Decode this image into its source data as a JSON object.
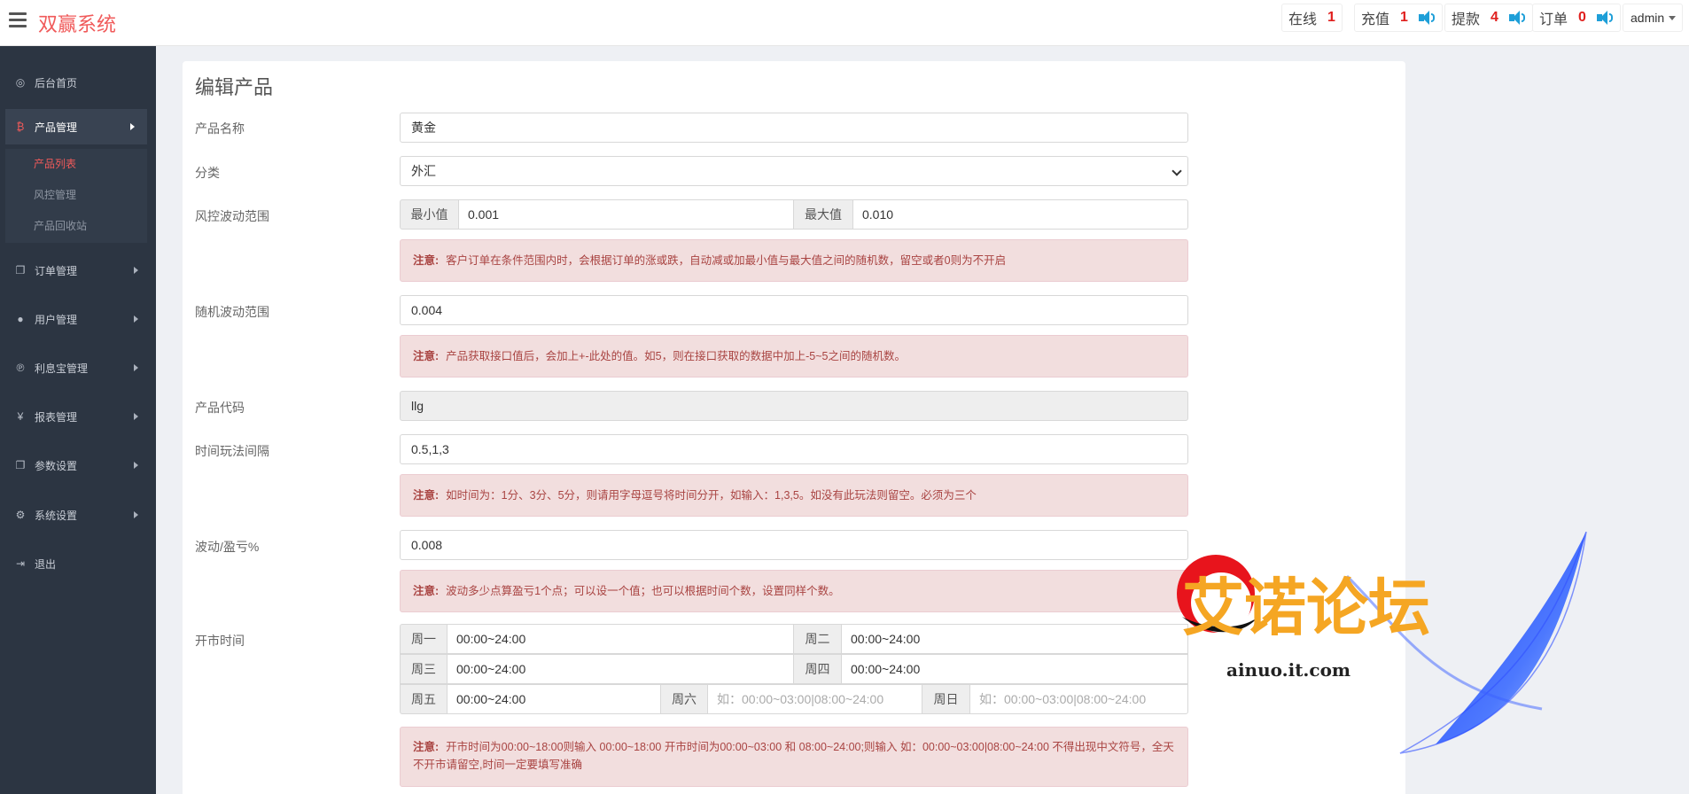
{
  "header": {
    "brand": "双赢系统",
    "stats": [
      {
        "label": "在线",
        "value": "1",
        "speaker": false
      },
      {
        "label": "充值",
        "value": "1",
        "speaker": true
      },
      {
        "label": "提款",
        "value": "4",
        "speaker": true
      },
      {
        "label": "订单",
        "value": "0",
        "speaker": true
      }
    ],
    "user": "admin"
  },
  "sidebar": {
    "items": [
      {
        "label": "后台首页",
        "icon": "dashboard-icon"
      },
      {
        "label": "产品管理",
        "icon": "bitcoin-icon"
      },
      {
        "label": "订单管理",
        "icon": "copy-icon"
      },
      {
        "label": "用户管理",
        "icon": "user-icon"
      },
      {
        "label": "利息宝管理",
        "icon": "pinterest-icon"
      },
      {
        "label": "报表管理",
        "icon": "yen-icon"
      },
      {
        "label": "参数设置",
        "icon": "copy-icon"
      },
      {
        "label": "系统设置",
        "icon": "cogs-icon"
      },
      {
        "label": "退出",
        "icon": "sign-out-icon"
      }
    ],
    "sub_items": [
      "产品列表",
      "风控管理",
      "产品回收站"
    ]
  },
  "form": {
    "title": "编辑产品",
    "name_label": "产品名称",
    "name_value": "黄金",
    "category_label": "分类",
    "category_value": "外汇",
    "risk_label": "风控波动范围",
    "min_label": "最小值",
    "min_value": "0.001",
    "max_label": "最大值",
    "max_value": "0.010",
    "note_prefix": "注意:",
    "risk_note": "客户订单在条件范围内时，会根据订单的涨或跌，自动减或加最小值与最大值之间的随机数，留空或者0则为不开启",
    "random_label": "随机波动范围",
    "random_value": "0.004",
    "random_note": "产品获取接口值后，会加上+-此处的值。如5，则在接口获取的数据中加上-5~5之间的随机数。",
    "code_label": "产品代码",
    "code_value": "llg",
    "interval_label": "时间玩法间隔",
    "interval_value": "0.5,1,3",
    "interval_note": "如时间为：1分、3分、5分，则请用字母逗号将时间分开，如输入：1,3,5。如没有此玩法则留空。必须为三个",
    "profit_label": "波动/盈亏%",
    "profit_value": "0.008",
    "profit_note": "波动多少点算盈亏1个点；可以设一个值；也可以根据时间个数，设置同样个数。",
    "market_label": "开市时间",
    "days": [
      {
        "label": "周一",
        "value": "00:00~24:00"
      },
      {
        "label": "周二",
        "value": "00:00~24:00"
      },
      {
        "label": "周三",
        "value": "00:00~24:00"
      },
      {
        "label": "周四",
        "value": "00:00~24:00"
      },
      {
        "label": "周五",
        "value": "00:00~24:00"
      },
      {
        "label": "周六",
        "placeholder": "如：00:00~03:00|08:00~24:00"
      },
      {
        "label": "周日",
        "placeholder": "如：00:00~03:00|08:00~24:00"
      }
    ],
    "market_note": "开市时间为00:00~18:00则输入 00:00~18:00 开市时间为00:00~03:00 和 08:00~24:00;则输入 如：00:00~03:00|08:00~24:00 不得出现中文符号，全天不开市请留空,时间一定要填写准确"
  },
  "watermark": {
    "text": "艾诺论坛",
    "url": "ainuo.it.com"
  },
  "colors": {
    "brand": "#f05a5a",
    "sidebar_bg": "#2c3542",
    "alert_bg": "#f2dede",
    "alert_text": "#a94442",
    "stat_number": "#e0201e",
    "speaker": "#1e9fd8"
  }
}
